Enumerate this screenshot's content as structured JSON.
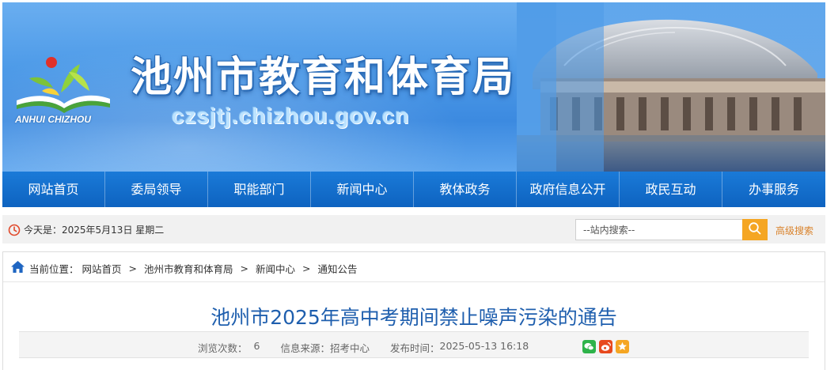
{
  "header": {
    "logo_text": "ANHUI CHIZHOU",
    "title": "池州市教育和体育局",
    "url": "czsjtj.chizhou.gov.cn"
  },
  "nav": {
    "items": [
      "网站首页",
      "委局领导",
      "职能部门",
      "新闻中心",
      "教体政务",
      "政府信息公开",
      "政民互动",
      "办事服务"
    ]
  },
  "infobar": {
    "date": "今天是：2025年5月13日 星期二",
    "search_placeholder": "--站内搜索--",
    "advanced_search": "高级搜索"
  },
  "breadcrumb": {
    "label": "当前位置：",
    "items": [
      "网站首页",
      "池州市教育和体育局",
      "新闻中心",
      "通知公告"
    ],
    "separator": ">"
  },
  "article": {
    "title": "池州市2025年高中考期间禁止噪声污染的通告",
    "views_label": "浏览次数：",
    "views": "6",
    "source_label": "信息来源：",
    "source": "招考中心",
    "time_label": "发布时间：",
    "time": "2025-05-13 16:18"
  },
  "share": {
    "icons": [
      "wechat-icon",
      "weibo-icon",
      "favorite-icon"
    ],
    "colors": {
      "wechat": "#2eb34a",
      "weibo": "#e8491d",
      "favorite": "#f5a623"
    }
  },
  "colors": {
    "nav": "#0e63c0",
    "title": "#1f5fae",
    "accent": "#f5a623"
  }
}
